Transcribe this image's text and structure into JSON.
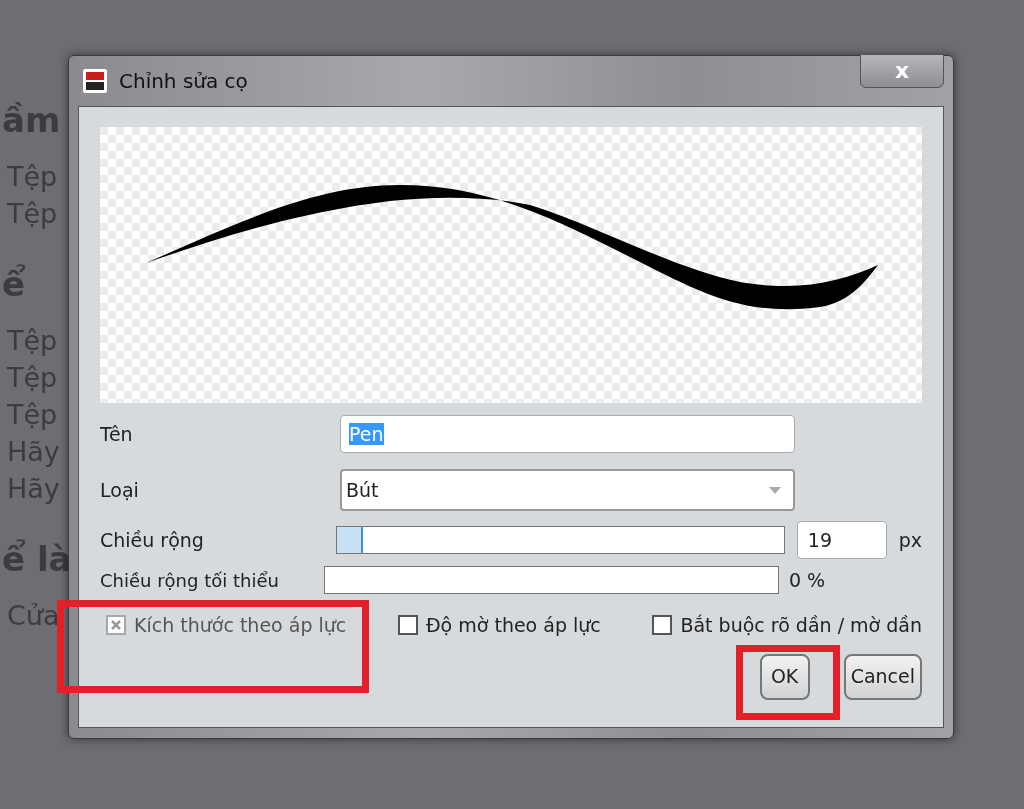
{
  "background_page": [
    {
      "kind": "heading",
      "text": "ầm"
    },
    {
      "kind": "line",
      "text": "Tệp"
    },
    {
      "kind": "line",
      "text": "Tệp"
    },
    {
      "kind": "heading",
      "text": "ể"
    },
    {
      "kind": "line",
      "text": "Tệp"
    },
    {
      "kind": "line",
      "text": "Tệp"
    },
    {
      "kind": "line",
      "text": "Tệp"
    },
    {
      "kind": "line",
      "text": "Hãy"
    },
    {
      "kind": "line",
      "text": "Hãy"
    },
    {
      "kind": "heading",
      "text": "ể là"
    },
    {
      "kind": "line",
      "text": "Cửa"
    }
  ],
  "dialog": {
    "title": "Chỉnh sửa cọ",
    "close": "x",
    "name": {
      "label": "Tên",
      "value": "Pen"
    },
    "type": {
      "label": "Loại",
      "value": "Bút"
    },
    "width": {
      "label": "Chiều rộng",
      "level": 0.06,
      "value": "19",
      "unit": "px"
    },
    "min_width": {
      "label": "Chiều rộng tối thiểu",
      "level": 0,
      "reading": "0 %"
    },
    "checkboxes": [
      {
        "label": "Kích thước theo áp lực",
        "checked": true,
        "disabled": true
      },
      {
        "label": "Độ mờ theo áp lực",
        "checked": false,
        "disabled": false
      },
      {
        "label": "Bắt buộc rõ dần / mờ dần",
        "checked": false,
        "disabled": false
      }
    ],
    "buttons": [
      "OK",
      "Cancel"
    ]
  },
  "annotations": [
    {
      "kind": "highlight"
    },
    {
      "kind": "highlight"
    }
  ]
}
